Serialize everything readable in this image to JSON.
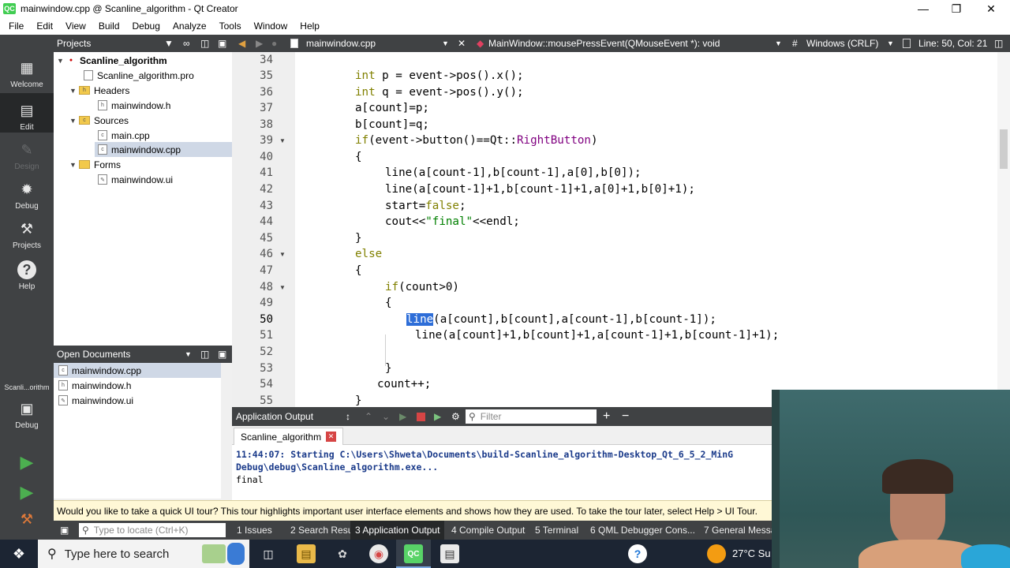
{
  "window": {
    "title": "mainwindow.cpp @ Scanline_algorithm - Qt Creator",
    "app_icon": "QC",
    "minimize": "—",
    "maximize": "❐",
    "close": "✕"
  },
  "menu": [
    "File",
    "Edit",
    "View",
    "Build",
    "Debug",
    "Analyze",
    "Tools",
    "Window",
    "Help"
  ],
  "modes": {
    "welcome": "Welcome",
    "edit": "Edit",
    "design": "Design",
    "debug": "Debug",
    "projects": "Projects",
    "help": "Help",
    "kit": "Scanli...orithm",
    "kit_mode": "Debug"
  },
  "projects_panel": {
    "title": "Projects",
    "items": [
      {
        "label": "Scanline_algorithm",
        "kind": "project"
      },
      {
        "label": "Scanline_algorithm.pro",
        "kind": "file"
      },
      {
        "label": "Headers",
        "kind": "folder"
      },
      {
        "label": "mainwindow.h",
        "kind": "file"
      },
      {
        "label": "Sources",
        "kind": "folder"
      },
      {
        "label": "main.cpp",
        "kind": "file"
      },
      {
        "label": "mainwindow.cpp",
        "kind": "file"
      },
      {
        "label": "Forms",
        "kind": "folder"
      },
      {
        "label": "mainwindow.ui",
        "kind": "file"
      }
    ]
  },
  "open_documents": {
    "title": "Open Documents",
    "items": [
      "mainwindow.cpp",
      "mainwindow.h",
      "mainwindow.ui"
    ]
  },
  "editor_toolbar": {
    "file": "mainwindow.cpp",
    "symbol": "MainWindow::mousePressEvent(QMouseEvent *): void",
    "hash": "#",
    "encoding": "Windows (CRLF)",
    "position": "Line: 50, Col: 21"
  },
  "editor": {
    "line_numbers": [
      "34",
      "35",
      "36",
      "37",
      "38",
      "39",
      "40",
      "41",
      "42",
      "43",
      "44",
      "45",
      "46",
      "47",
      "48",
      "49",
      "50",
      "51",
      "52",
      "53",
      "54",
      "55"
    ],
    "current_line": "50"
  },
  "output": {
    "header": "Application Output",
    "filter_placeholder": "Filter",
    "tab": "Scanline_algorithm",
    "lines": [
      "11:44:07: Starting C:\\Users\\Shweta\\Documents\\build-Scanline_algorithm-Desktop_Qt_6_5_2_MinG",
      "Debug\\debug\\Scanline_algorithm.exe...",
      "final"
    ]
  },
  "tour": "Would you like to take a quick UI tour? This tour highlights important user interface elements and shows how they are used. To take the tour later, select Help > UI Tour.",
  "status": {
    "locator_placeholder": "Type to locate (Ctrl+K)",
    "tabs": [
      "1  Issues",
      "2  Search Resu...",
      "3  Application Output",
      "4  Compile Output",
      "5  Terminal",
      "6  QML Debugger Cons...",
      "7  General Messag"
    ]
  },
  "taskbar": {
    "search_placeholder": "Type here to search",
    "weather": "27°C  Su"
  },
  "colors": {
    "dark_panel": "#404244",
    "selection": "#2e6ed8",
    "keyword": "#808000",
    "string": "#008000"
  }
}
